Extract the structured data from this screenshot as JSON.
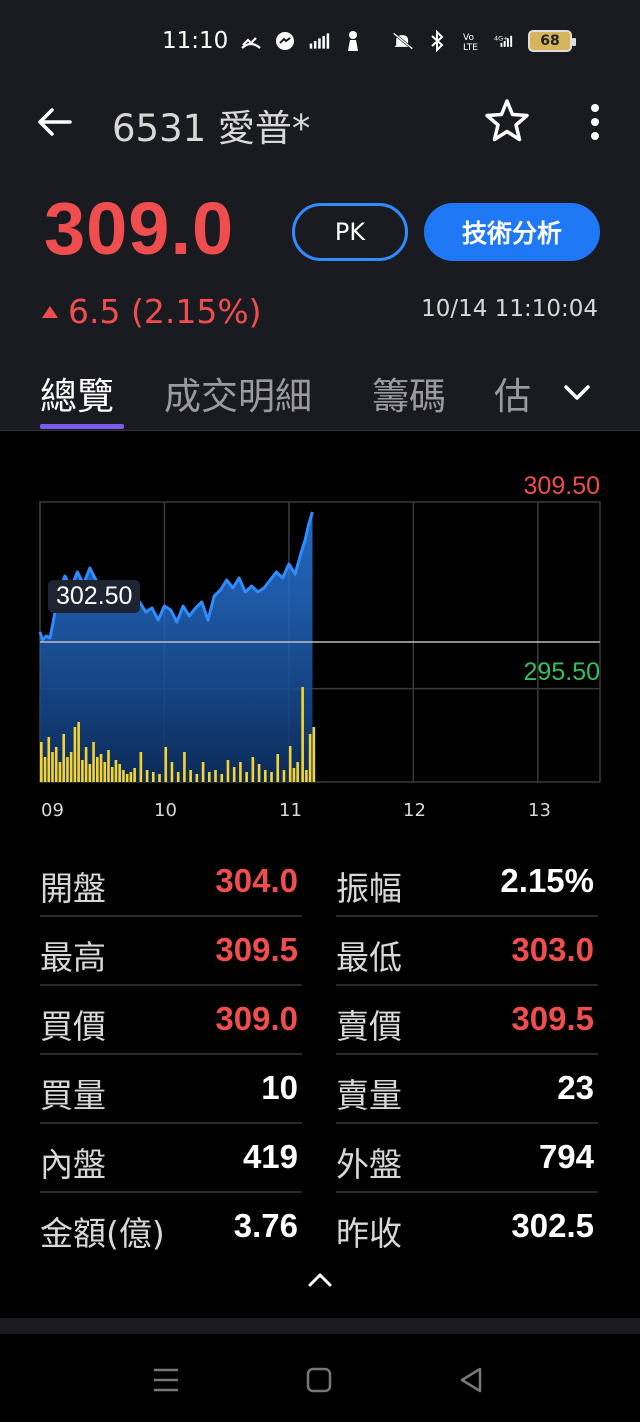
{
  "status_bar": {
    "time": "11:10",
    "icons": [
      "missed-call-icon",
      "messenger-icon",
      "signal-stats-icon",
      "figure-icon"
    ],
    "right_icons": [
      "mute-icon",
      "bluetooth-icon",
      "volte-icon",
      "4g-signal-icon"
    ],
    "battery": "68"
  },
  "header": {
    "title": "6531 愛普*",
    "price": "309.0",
    "pk_label": "PK",
    "tech_label": "技術分析",
    "change": "6.5 (2.15%)",
    "timestamp": "10/14 11:10:04"
  },
  "tabs": [
    {
      "label": "總覽",
      "active": true
    },
    {
      "label": "成交明細",
      "active": false
    },
    {
      "label": "籌碼",
      "active": false
    },
    {
      "label": "估",
      "active": false
    }
  ],
  "chart_data": {
    "type": "area",
    "y_high_label": "309.50",
    "y_low_label": "295.50",
    "reference_label": "302.50",
    "reference": 302.5,
    "ylim": [
      295.5,
      309.5
    ],
    "x_ticks": [
      "09",
      "10",
      "11",
      "12",
      "13"
    ],
    "x_range": [
      9.0,
      13.5
    ],
    "series": [
      {
        "x": [
          9.0,
          9.02,
          9.05,
          9.08,
          9.1,
          9.15,
          9.2,
          9.25,
          9.3,
          9.35,
          9.4,
          9.45,
          9.5,
          9.55,
          9.6,
          9.65,
          9.7,
          9.75,
          9.8,
          9.85,
          9.9,
          9.95,
          10.0,
          10.05,
          10.1,
          10.15,
          10.2,
          10.25,
          10.3,
          10.35,
          10.4,
          10.45,
          10.5,
          10.55,
          10.6,
          10.65,
          10.7,
          10.75,
          10.8,
          10.85,
          10.9,
          10.95,
          11.0,
          11.05,
          11.1,
          11.13,
          11.16,
          11.19
        ],
        "values": [
          303.0,
          302.6,
          302.8,
          302.7,
          303.3,
          305.0,
          305.8,
          305.2,
          306.0,
          305.4,
          306.2,
          305.6,
          305.0,
          305.2,
          304.8,
          304.9,
          304.6,
          304.3,
          304.5,
          304.0,
          304.2,
          303.6,
          304.3,
          304.1,
          303.5,
          304.3,
          303.8,
          304.2,
          304.5,
          303.6,
          304.8,
          305.1,
          305.6,
          305.2,
          305.7,
          305.0,
          305.3,
          305.0,
          305.2,
          305.6,
          306.0,
          305.7,
          306.4,
          305.9,
          307.0,
          307.6,
          308.4,
          309.0
        ]
      }
    ],
    "volume": [
      {
        "x": [
          9.0,
          9.03,
          9.06,
          9.09,
          9.12,
          9.15,
          9.18,
          9.21,
          9.24,
          9.27,
          9.3,
          9.33,
          9.36,
          9.39,
          9.42,
          9.45,
          9.48,
          9.51,
          9.54,
          9.57,
          9.6,
          9.63,
          9.66,
          9.69,
          9.72,
          9.75,
          9.8,
          9.85,
          9.9,
          9.95,
          10.0,
          10.05,
          10.1,
          10.15,
          10.2,
          10.25,
          10.3,
          10.35,
          10.4,
          10.45,
          10.5,
          10.55,
          10.6,
          10.65,
          10.7,
          10.75,
          10.8,
          10.85,
          10.9,
          10.95,
          11.0,
          11.03,
          11.06,
          11.1,
          11.13,
          11.16,
          11.19
        ],
        "values": [
          40,
          25,
          45,
          30,
          35,
          20,
          48,
          25,
          30,
          55,
          60,
          22,
          35,
          18,
          40,
          25,
          28,
          20,
          32,
          15,
          22,
          18,
          12,
          8,
          10,
          14,
          30,
          12,
          10,
          8,
          35,
          20,
          10,
          30,
          12,
          8,
          20,
          10,
          12,
          8,
          22,
          15,
          20,
          10,
          25,
          18,
          12,
          10,
          28,
          12,
          36,
          14,
          20,
          95,
          12,
          48,
          55
        ]
      }
    ]
  },
  "quotes": {
    "left": [
      {
        "label": "開盤",
        "value": "304.0",
        "color": "#f04e4e"
      },
      {
        "label": "最高",
        "value": "309.5",
        "color": "#f04e4e"
      },
      {
        "label": "買價",
        "value": "309.0",
        "color": "#f04e4e"
      },
      {
        "label": "買量",
        "value": "10",
        "color": "#ffffff"
      },
      {
        "label": "內盤",
        "value": "419",
        "color": "#ffffff"
      },
      {
        "label": "金額(億)",
        "value": "3.76",
        "color": "#ffffff"
      }
    ],
    "right": [
      {
        "label": "振幅",
        "value": "2.15%",
        "color": "#ffffff"
      },
      {
        "label": "最低",
        "value": "303.0",
        "color": "#f04e4e"
      },
      {
        "label": "賣價",
        "value": "309.5",
        "color": "#f04e4e"
      },
      {
        "label": "賣量",
        "value": "23",
        "color": "#ffffff"
      },
      {
        "label": "外盤",
        "value": "794",
        "color": "#ffffff"
      },
      {
        "label": "昨收",
        "value": "302.5",
        "color": "#ffffff"
      }
    ]
  },
  "colors": {
    "up": "#f04e4e",
    "down": "#36c05d",
    "accent": "#1f78f5",
    "line": "#2f8cff",
    "volume": "#f5d430",
    "tab_indicator": "#7c5cf0"
  }
}
